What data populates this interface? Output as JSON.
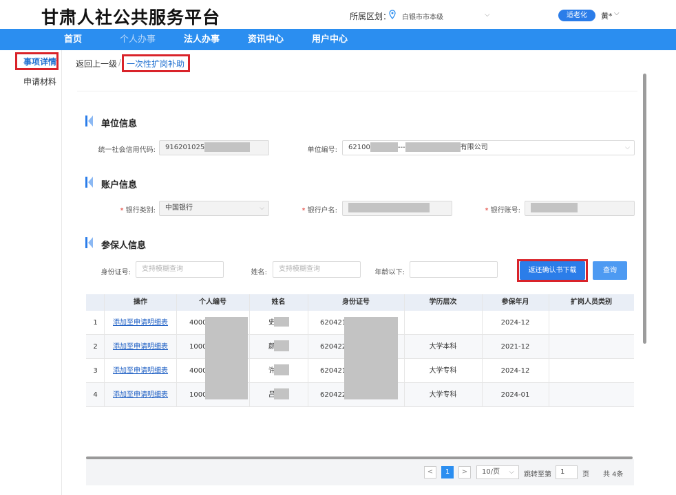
{
  "header": {
    "site_title": "甘肃人社公共服务平台",
    "region_label": "所属区划：",
    "region_value": "白银市市本级",
    "elder_mode": "适老化",
    "user_name": "黄*"
  },
  "nav": {
    "items": [
      "首页",
      "个人办事",
      "法人办事",
      "资讯中心",
      "用户中心"
    ]
  },
  "sidebar": {
    "items": [
      "事项详情",
      "申请材料"
    ]
  },
  "breadcrumb": {
    "back": "返回上一级",
    "separator": "/",
    "current": "一次性扩岗补助"
  },
  "unit_info": {
    "title": "单位信息",
    "credit_code_label": "统一社会信用代码:",
    "credit_code_value": "916201025",
    "unit_no_label": "单位编号:",
    "unit_no_prefix": "62100",
    "unit_no_mid": "---",
    "unit_no_suffix": "有限公司"
  },
  "account_info": {
    "title": "账户信息",
    "bank_type_label": "银行类别:",
    "bank_type_value": "中国银行",
    "account_name_label": "银行户名:",
    "account_no_label": "银行账号:",
    "required_mark": "*"
  },
  "insured_info": {
    "title": "参保人信息",
    "id_label": "身份证号:",
    "id_placeholder": "支持模糊查询",
    "name_label": "姓名:",
    "name_placeholder": "支持模糊查询",
    "age_label": "年龄以下:",
    "confirm_button": "返还确认书下载",
    "query_button": "查询"
  },
  "table": {
    "headers": [
      "操作",
      "个人编号",
      "姓名",
      "身份证号",
      "学历层次",
      "参保年月",
      "扩岗人员类别"
    ],
    "rows": [
      {
        "index": "1",
        "action": "添加至申请明细表",
        "person_no": "4000",
        "name": "史",
        "id_no": "620421",
        "education": "",
        "insured_month": "2024-12",
        "category": ""
      },
      {
        "index": "2",
        "action": "添加至申请明细表",
        "person_no": "1000",
        "name": "颜",
        "id_no": "620422",
        "education": "大学本科",
        "insured_month": "2021-12",
        "category": ""
      },
      {
        "index": "3",
        "action": "添加至申请明细表",
        "person_no": "4000",
        "name": "许",
        "id_no": "620421",
        "education": "大学专科",
        "insured_month": "2024-12",
        "category": ""
      },
      {
        "index": "4",
        "action": "添加至申请明细表",
        "person_no": "1000",
        "name": "吕",
        "id_no": "620422",
        "education": "大学专科",
        "insured_month": "2024-01",
        "category": ""
      }
    ]
  },
  "pagination": {
    "prev": "<",
    "current_page": "1",
    "next": ">",
    "page_size": "10/页",
    "jump_label": "跳转至第",
    "jump_value": "1",
    "page_unit": "页",
    "total": "共 4条"
  },
  "colors": {
    "brand_blue": "#2b8ef0",
    "highlight_red": "#d9232a",
    "link_blue": "#1e5fc4"
  }
}
